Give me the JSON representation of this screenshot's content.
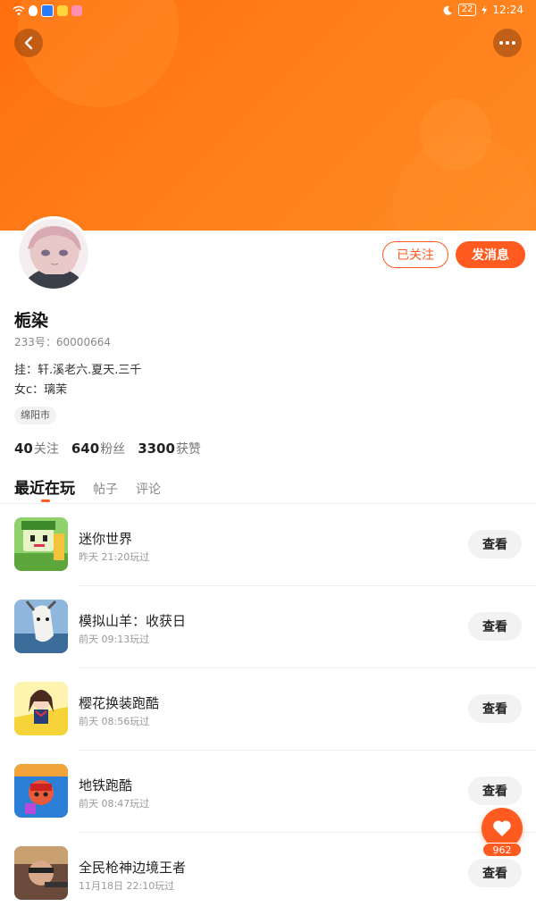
{
  "status_bar": {
    "battery": "22",
    "time": "12:24"
  },
  "header": {
    "back_icon": "chevron-left-icon",
    "more_icon": "more-dots-icon"
  },
  "profile": {
    "name": "栀染",
    "uid": "233号：60000664",
    "bio_lines": [
      "挂：轩.溪老六.夏天.三千",
      "女c：璃茉"
    ],
    "location": "绵阳市",
    "followed_label": "已关注",
    "message_label": "发消息",
    "stats": [
      {
        "value": "40",
        "label": "关注"
      },
      {
        "value": "640",
        "label": "粉丝"
      },
      {
        "value": "3300",
        "label": "获赞"
      }
    ]
  },
  "tabs": [
    {
      "label": "最近在玩",
      "active": true
    },
    {
      "label": "帖子",
      "active": false
    },
    {
      "label": "评论",
      "active": false
    }
  ],
  "games": [
    {
      "name": "迷你世界",
      "time": "昨天 21:20玩过",
      "action": "查看"
    },
    {
      "name": "模拟山羊：收获日",
      "time": "前天 09:13玩过",
      "action": "查看"
    },
    {
      "name": "樱花换装跑酷",
      "time": "前天 08:56玩过",
      "action": "查看"
    },
    {
      "name": "地铁跑酷",
      "time": "前天 08:47玩过",
      "action": "查看"
    },
    {
      "name": "全民枪神边境王者",
      "time": "11月18日 22:10玩过",
      "action": "查看"
    }
  ],
  "like_fab": {
    "count": "962",
    "icon": "heart-icon"
  },
  "colors": {
    "accent": "#ff5a1f",
    "banner": "#ff7e1a"
  }
}
